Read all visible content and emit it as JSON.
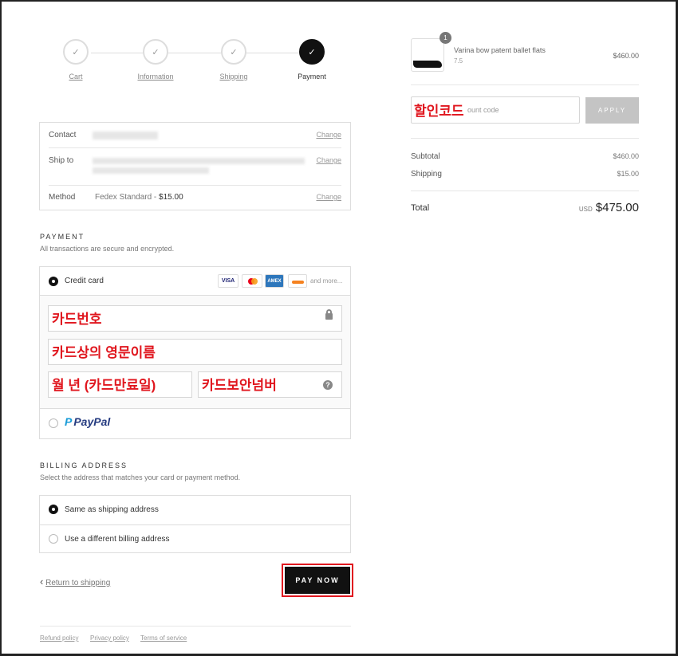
{
  "steps": [
    {
      "label": "Cart",
      "icon": "check-icon",
      "glyph": "✓",
      "active": false
    },
    {
      "label": "Information",
      "icon": "check-icon",
      "glyph": "✓",
      "active": false
    },
    {
      "label": "Shipping",
      "icon": "check-icon",
      "glyph": "✓",
      "active": false
    },
    {
      "label": "Payment",
      "icon": "check-icon",
      "glyph": "✓",
      "active": true
    }
  ],
  "summary": {
    "contact_label": "Contact",
    "shipto_label": "Ship to",
    "method_label": "Method",
    "method_value": "Fedex Standard - ",
    "method_price": "$15.00",
    "change_label": "Change"
  },
  "payment": {
    "heading": "PAYMENT",
    "subtitle": "All transactions are secure and encrypted.",
    "credit_card_label": "Credit card",
    "cards": [
      "VISA",
      "MC",
      "AMEX",
      "DISC"
    ],
    "and_more": "and more...",
    "card_number_overlay": "카드번호",
    "name_overlay": "카드상의 영문이름",
    "expiry_overlay": "월 년 (카드만료일)",
    "cvv_overlay": "카드보안넘버",
    "paypal_label": "PayPal"
  },
  "billing": {
    "heading": "BILLING ADDRESS",
    "subtitle": "Select the address that matches your card or payment method.",
    "same_label": "Same as shipping address",
    "different_label": "Use a different billing address"
  },
  "actions": {
    "back_label": "Return to shipping",
    "back_arrow": "‹",
    "pay_label": "PAY NOW"
  },
  "footer": {
    "refund": "Refund policy",
    "privacy": "Privacy policy",
    "terms": "Terms of service"
  },
  "order": {
    "qty": "1",
    "product_name": "Varina bow patent ballet flats",
    "variant": "7.5",
    "price": "$460.00",
    "discount_overlay": "할인코드",
    "discount_placeholder": "ount code",
    "apply_label": "APPLY",
    "subtotal_label": "Subtotal",
    "subtotal_value": "$460.00",
    "shipping_label": "Shipping",
    "shipping_value": "$15.00",
    "total_label": "Total",
    "currency": "USD",
    "total_value": "$475.00"
  },
  "colors": {
    "accent": "#111111",
    "highlight": "#e0161e"
  }
}
